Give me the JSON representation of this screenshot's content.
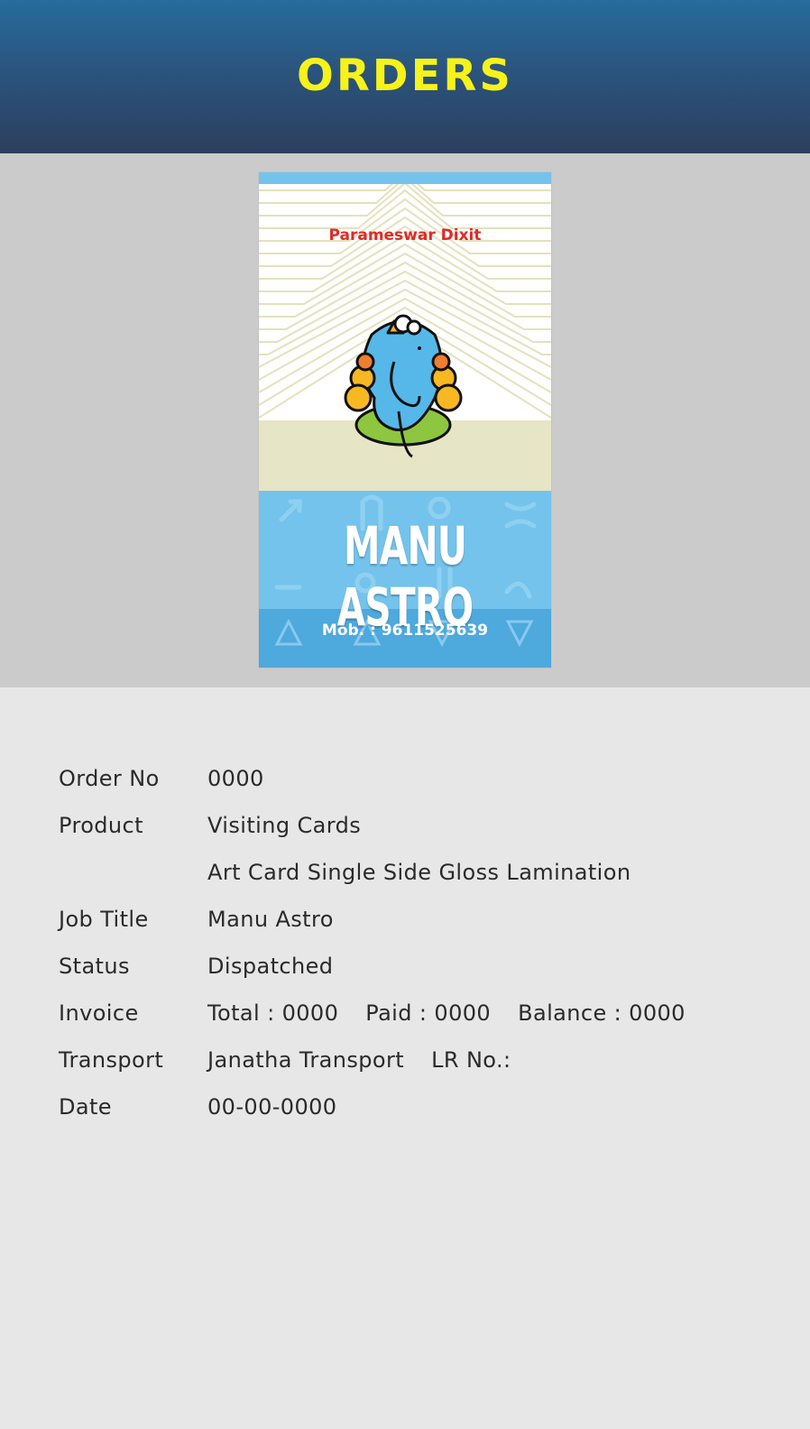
{
  "header": {
    "title": "ORDERS"
  },
  "card": {
    "person": "Parameswar Dixit",
    "brand": "MANU ASTRO",
    "mobile": "Mob. : 9611525639",
    "colors": {
      "blue": "#74c3ec",
      "dark_blue": "#4ea9dc",
      "beige": "#e6e5c5",
      "red": "#e02a27"
    }
  },
  "details": {
    "order_no": {
      "label": "Order No",
      "value": "0000"
    },
    "product": {
      "label": "Product",
      "value": "Visiting Cards",
      "value2": "Art Card Single Side Gloss Lamination"
    },
    "job_title": {
      "label": "Job Title",
      "value": "Manu Astro"
    },
    "status": {
      "label": "Status",
      "value": "Dispatched"
    },
    "invoice": {
      "label": "Invoice",
      "total": "Total : 0000",
      "paid": "Paid : 0000",
      "balance": "Balance : 0000"
    },
    "transport": {
      "label": "Transport",
      "value": "Janatha Transport",
      "lr": "LR No.:"
    },
    "date": {
      "label": "Date",
      "value": "00-00-0000"
    }
  },
  "colors": {
    "header_accent": "#f6f21a",
    "header_bg": "#2b5078"
  }
}
